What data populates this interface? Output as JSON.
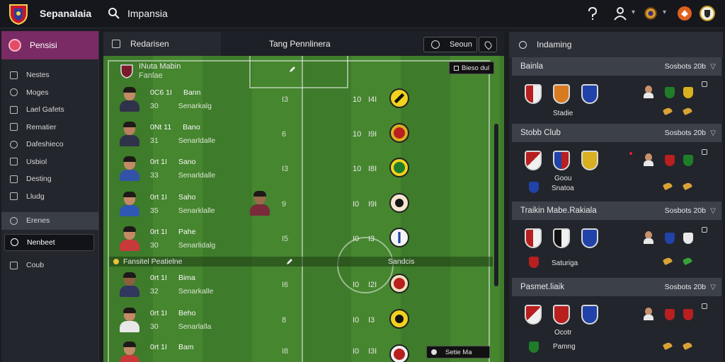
{
  "topbar": {
    "brand": "Sepanalaia",
    "search_text": "Impansia",
    "icons": [
      "crest-logo",
      "search-icon",
      "help-icon",
      "profile-icon",
      "coin-icon",
      "alert-icon",
      "club-icon"
    ]
  },
  "sidebar": {
    "header": "Pensisi",
    "items": [
      {
        "label": "Nestes",
        "icon": "square-icon"
      },
      {
        "label": "Moges",
        "icon": "search-icon"
      },
      {
        "label": "Lael Gafets",
        "icon": "gift-icon"
      },
      {
        "label": "Rematier",
        "icon": "refresh-icon"
      },
      {
        "label": "Dafeshieco",
        "icon": "ball-icon"
      },
      {
        "label": "Usbiol",
        "icon": "list-icon"
      },
      {
        "label": "Desting",
        "icon": "chart-icon"
      },
      {
        "label": "Lludg",
        "icon": "doc-icon"
      },
      {
        "label": "Erenes",
        "icon": "tag-icon"
      },
      {
        "label": "Nenbeet",
        "icon": "circle-icon"
      },
      {
        "label": "Coub",
        "icon": "square-icon"
      }
    ]
  },
  "center": {
    "tab_left": "Redarisen",
    "tab_title": "Tang Pennlinera",
    "search_label": "Seoun",
    "section1": {
      "label": "INuta Mabin",
      "sub": "Fanlae",
      "tag": "Bieso dul"
    },
    "section2": {
      "label": "Fansitel Peatielne",
      "tag": "Sandcis"
    },
    "footer_tag": "Setie Ma",
    "players": [
      {
        "code": "0C6 1I",
        "name": "Bann",
        "num": "30",
        "team": "Senarkalg",
        "n1": "I3",
        "n2": "10",
        "n3": "I4I",
        "badge_bg": "#f1d21e",
        "badge_in": "#111"
      },
      {
        "code": "0Nt 11",
        "name": "Bano",
        "num": "31",
        "team": "Senarldalle",
        "n1": "6",
        "n2": "10",
        "n3": "I9I",
        "badge_bg": "#d9b01f",
        "badge_in": "#b81f1f"
      },
      {
        "code": "0rt 1I",
        "name": "Sano",
        "num": "33",
        "team": "Senarldalle",
        "n1": "I3",
        "n2": "10",
        "n3": "I8I",
        "badge_bg": "#dfe7d0",
        "badge_in": "#1f7d2a"
      },
      {
        "code": "0rt 1I",
        "name": "Saho",
        "num": "35",
        "team": "Senarklalle",
        "n1": "9",
        "n2": "I0",
        "n3": "I9I",
        "badge_bg": "#f5e6d0",
        "badge_in": "#161616"
      },
      {
        "code": "0rt 1I",
        "name": "Pahe",
        "num": "30",
        "team": "Senarlidalg",
        "n1": "I5",
        "n2": "I0",
        "n3": "I3",
        "badge_bg": "#f4f4f4",
        "badge_in": "#2142a8"
      },
      {
        "code": "0rt 1I",
        "name": "Bima",
        "num": "32",
        "team": "Senarkalle",
        "n1": "I6",
        "n2": "I0",
        "n3": "I2I",
        "badge_bg": "#ece0bb",
        "badge_in": "#b81f1f"
      },
      {
        "code": "0rt 1I",
        "name": "Beho",
        "num": "30",
        "team": "Senarlalla",
        "n1": "8",
        "n2": "I0",
        "n3": "I3",
        "badge_bg": "#f1d21e",
        "badge_in": "#111"
      },
      {
        "code": "0rt 1I",
        "name": "Bam",
        "num": "",
        "team": "",
        "n1": "I8",
        "n2": "I0",
        "n3": "I3I",
        "badge_bg": "#f1f1f1",
        "badge_in": "#b81f1f"
      }
    ]
  },
  "right": {
    "title": "Indaming",
    "clubs": [
      {
        "name": "Bainla",
        "stat": "Sosbots 20b",
        "caption": "Stadie",
        "sub": ""
      },
      {
        "name": "Stobb Club",
        "stat": "Sosbots 20b",
        "caption": "Goou",
        "sub": "Snatoa"
      },
      {
        "name": "Traikin Mabe.Rakiala",
        "stat": "Sosbots 20b",
        "caption": "",
        "sub": "Saturiga"
      },
      {
        "name": "Pasmet.liaik",
        "stat": "Sosbots 20b",
        "caption": "Ocotr",
        "sub": "Pamng"
      }
    ]
  },
  "colors": {
    "topbar": "#15171c",
    "sidebar_accent": "#7a2a64",
    "pitch_a": "#3e7b2a",
    "pitch_b": "#46862f",
    "panel": "#22252c"
  }
}
